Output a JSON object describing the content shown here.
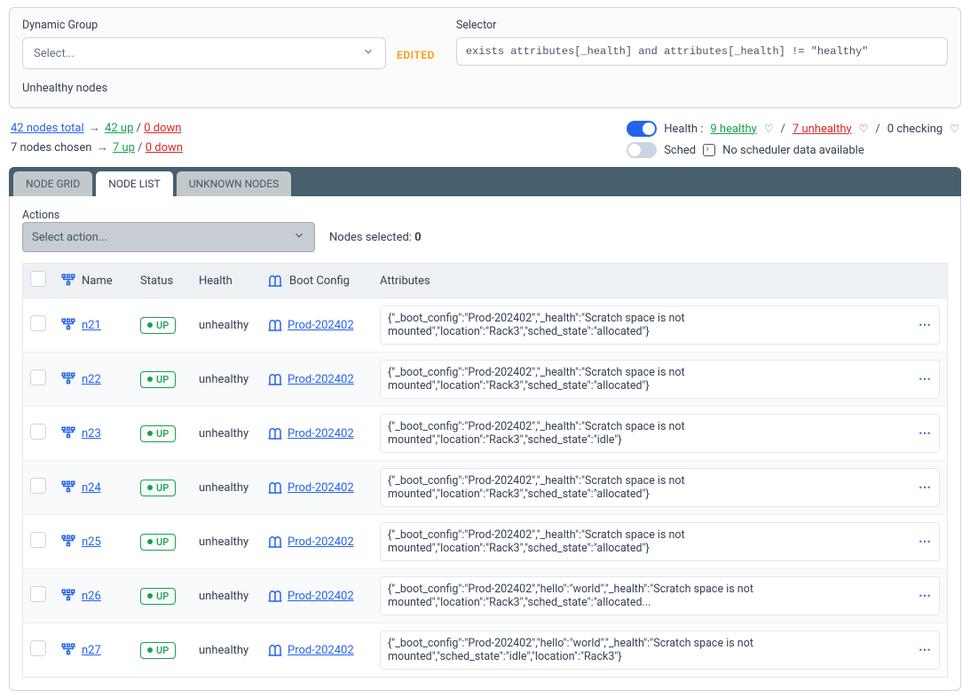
{
  "top": {
    "dynamic_group_label": "Dynamic Group",
    "dynamic_group_value": "Select...",
    "edited_badge": "EDITED",
    "selector_label": "Selector",
    "selector_value": "exists attributes[_health] and attributes[_health] != \"healthy\"",
    "subline": "Unhealthy nodes"
  },
  "summary": {
    "total_nodes": "42 nodes total",
    "total_up": "42 up",
    "total_down": "0 down",
    "chosen_nodes": "7 nodes chosen",
    "chosen_up": "7 up",
    "chosen_down": "0 down",
    "health_label": "Health :",
    "health_healthy": "9 healthy",
    "health_unhealthy": "7 unhealthy",
    "health_checking": "0 checking",
    "sched_label": "Sched",
    "sched_value": "No scheduler data available"
  },
  "tabs": {
    "node_grid": "NODE GRID",
    "node_list": "NODE LIST",
    "unknown_nodes": "UNKNOWN NODES"
  },
  "actions": {
    "label": "Actions",
    "select_placeholder": "Select action...",
    "nodes_selected_prefix": "Nodes selected: ",
    "nodes_selected_count": "0"
  },
  "columns": {
    "name": "Name",
    "status": "Status",
    "health": "Health",
    "boot": "Boot Config",
    "attributes": "Attributes"
  },
  "rows": [
    {
      "name": "n21",
      "status": "UP",
      "health": "unhealthy",
      "boot": "Prod-202402",
      "attrs": "{\"_boot_config\":\"Prod-202402\",\"_health\":\"Scratch space is not mounted\",\"location\":\"Rack3\",\"sched_state\":\"allocated\"}"
    },
    {
      "name": "n22",
      "status": "UP",
      "health": "unhealthy",
      "boot": "Prod-202402",
      "attrs": "{\"_boot_config\":\"Prod-202402\",\"_health\":\"Scratch space is not mounted\",\"location\":\"Rack3\",\"sched_state\":\"allocated\"}"
    },
    {
      "name": "n23",
      "status": "UP",
      "health": "unhealthy",
      "boot": "Prod-202402",
      "attrs": "{\"_boot_config\":\"Prod-202402\",\"_health\":\"Scratch space is not mounted\",\"location\":\"Rack3\",\"sched_state\":\"idle\"}"
    },
    {
      "name": "n24",
      "status": "UP",
      "health": "unhealthy",
      "boot": "Prod-202402",
      "attrs": "{\"_boot_config\":\"Prod-202402\",\"_health\":\"Scratch space is not mounted\",\"location\":\"Rack3\",\"sched_state\":\"allocated\"}"
    },
    {
      "name": "n25",
      "status": "UP",
      "health": "unhealthy",
      "boot": "Prod-202402",
      "attrs": "{\"_boot_config\":\"Prod-202402\",\"_health\":\"Scratch space is not mounted\",\"location\":\"Rack3\",\"sched_state\":\"allocated\"}"
    },
    {
      "name": "n26",
      "status": "UP",
      "health": "unhealthy",
      "boot": "Prod-202402",
      "attrs": "{\"_boot_config\":\"Prod-202402\",\"hello\":\"world\",\"_health\":\"Scratch space is not mounted\",\"location\":\"Rack3\",\"sched_state\":\"allocated..."
    },
    {
      "name": "n27",
      "status": "UP",
      "health": "unhealthy",
      "boot": "Prod-202402",
      "attrs": "{\"_boot_config\":\"Prod-202402\",\"hello\":\"world\",\"_health\":\"Scratch space is not mounted\",\"sched_state\":\"idle\",\"location\":\"Rack3\"}"
    }
  ]
}
